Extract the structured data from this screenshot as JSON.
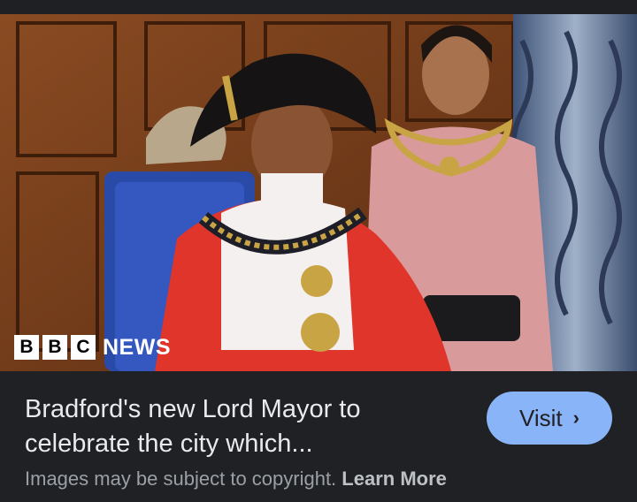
{
  "image": {
    "description_icon": "news-photo",
    "brand": {
      "letters": [
        "B",
        "B",
        "C"
      ],
      "word": "NEWS"
    }
  },
  "caption": {
    "title_line1": "Bradford's new Lord Mayor to",
    "title_line2": "celebrate the city which...",
    "visit_label": "Visit",
    "visit_icon": "chevron-right-icon",
    "copyright_text": "Images may be subject to copyright.",
    "learn_more": "Learn More"
  },
  "colors": {
    "background": "#202124",
    "accent": "#8ab4f8",
    "title": "#e8eaed",
    "muted": "#9aa0a6"
  }
}
